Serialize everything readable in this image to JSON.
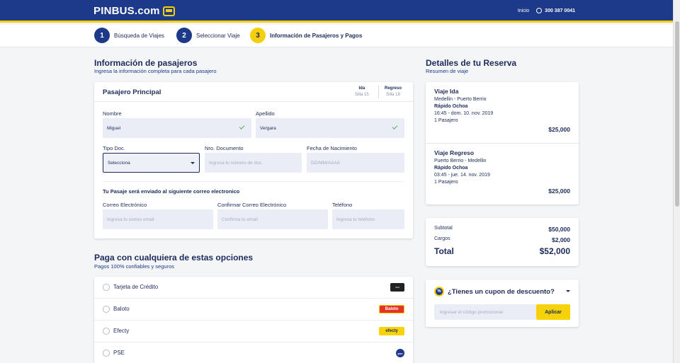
{
  "header": {
    "logo_text": "PINBUS.com",
    "nav_home": "Inicio",
    "phone": "300 387 0041"
  },
  "steps": [
    {
      "num": "1",
      "label": "Búsqueda de Viajes"
    },
    {
      "num": "2",
      "label": "Seleccionar Viaje"
    },
    {
      "num": "3",
      "label": "Información de Pasajeros y Pagos"
    }
  ],
  "passengers": {
    "title": "Información de pasajeros",
    "subtitle": "Ingresa la información completa para cada pasajero",
    "card_title": "Pasajero Principal",
    "seat_ida_label": "Ida",
    "seat_ida_value": "Silla 15",
    "seat_regreso_label": "Regreso",
    "seat_regreso_value": "Silla 18",
    "nombre_label": "Nombre",
    "nombre_value": "Miguel",
    "apellido_label": "Apellido",
    "apellido_value": "Vergara",
    "tipo_doc_label": "Tipo Doc.",
    "tipo_doc_value": "Selecciona",
    "nro_doc_label": "Nro. Documento",
    "nro_doc_placeholder": "Ingresa tu número de doc.",
    "fecha_label": "Fecha de Nacimiento",
    "fecha_placeholder": "DD/MM/AAAA",
    "email_note": "Tu Pasaje será enviado al siguiente correo electronico",
    "email_label": "Correo Electrónico",
    "email_placeholder": "Ingresa tu correo email",
    "confirm_label": "Confirmar Correo Electrónico",
    "confirm_placeholder": "Confirma tu email",
    "phone_label": "Teléfono",
    "phone_placeholder": "Ingresa tu teléfono"
  },
  "payment": {
    "title": "Paga con cualquiera de estas opciones",
    "subtitle": "Pagos 100% confiables y seguros",
    "options": [
      {
        "label": "Tarjeta de Crédito",
        "logo": "credit-card"
      },
      {
        "label": "Baloto",
        "logo": "Baloto"
      },
      {
        "label": "Efecty",
        "logo": "efecty"
      },
      {
        "label": "PSE",
        "logo": "pse"
      }
    ]
  },
  "reservation": {
    "title": "Detalles de tu Reserva",
    "subtitle": "Resumen de viaje",
    "ida": {
      "title": "Viaje Ida",
      "route": "Medellin - Puerto Berrio",
      "company": "Rápido Ochoa",
      "datetime": "16:45 - dom. 10. nov. 2019",
      "passengers": "1 Pasajero",
      "price": "$25,000"
    },
    "regreso": {
      "title": "Viaje Regreso",
      "route": "Puerto Berrio - Medellin",
      "company": "Rápido Ochoa",
      "datetime": "03:45 - jue. 14. nov. 2019",
      "passengers": "1 Pasajero",
      "price": "$25,000"
    }
  },
  "totals": {
    "subtotal_label": "Subtotal",
    "subtotal_value": "$50,000",
    "cargos_label": "Cargos",
    "cargos_value": "$2,000",
    "total_label": "Total",
    "total_value": "$52,000"
  },
  "coupon": {
    "icon_text": "%",
    "title": "¿Tienes un cupon de descuento?",
    "placeholder": "Ingresar el código promocional",
    "button": "Aplicar"
  },
  "colors": {
    "brand_blue": "#1d3989",
    "brand_yellow": "#f5cf0d"
  }
}
